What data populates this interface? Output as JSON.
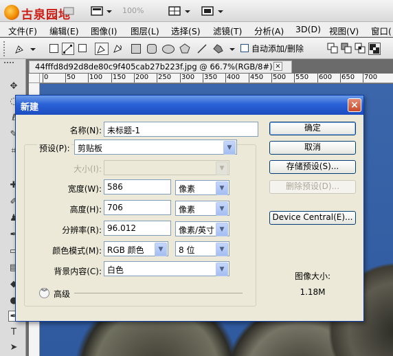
{
  "app": {
    "logo_text": "古泉园地",
    "zoom": "100%"
  },
  "menu": [
    "文件(F)",
    "编辑(E)",
    "图像(I)",
    "图层(L)",
    "选择(S)",
    "滤镜(T)",
    "分析(A)",
    "3D(D)",
    "视图(V)",
    "窗口("
  ],
  "options_bar": {
    "auto_add_label": "自动添加/删除"
  },
  "document": {
    "tab_title": "44fffd8d92d8de80c9f405cab27b223f.jpg @ 66.7%(RGB/8#) *",
    "close_glyph": "×",
    "ruler_marks": [
      "0",
      "50",
      "100",
      "150",
      "200",
      "250",
      "300",
      "350",
      "400",
      "450",
      "500",
      "550",
      "600",
      "650",
      "700"
    ]
  },
  "dialog": {
    "title": "新建",
    "close_glyph": "×",
    "name_label": "名称(N):",
    "name_value": "未标题-1",
    "preset_label": "预设(P):",
    "preset_value": "剪贴板",
    "size_label": "大小(I):",
    "size_value": "",
    "width_label": "宽度(W):",
    "width_value": "586",
    "width_unit": "像素",
    "height_label": "高度(H):",
    "height_value": "706",
    "height_unit": "像素",
    "resolution_label": "分辨率(R):",
    "resolution_value": "96.012",
    "resolution_unit": "像素/英寸",
    "color_mode_label": "颜色模式(M):",
    "color_mode_value": "RGB 颜色",
    "bit_depth_value": "8 位",
    "background_label": "背景内容(C):",
    "background_value": "白色",
    "advanced_label": "高级",
    "buttons": {
      "ok": "确定",
      "cancel": "取消",
      "save_preset": "存储预设(S)...",
      "delete_preset": "删除预设(D)...",
      "device_central": "Device Central(E)..."
    },
    "image_size_label": "图像大小:",
    "image_size_value": "1.18M"
  }
}
